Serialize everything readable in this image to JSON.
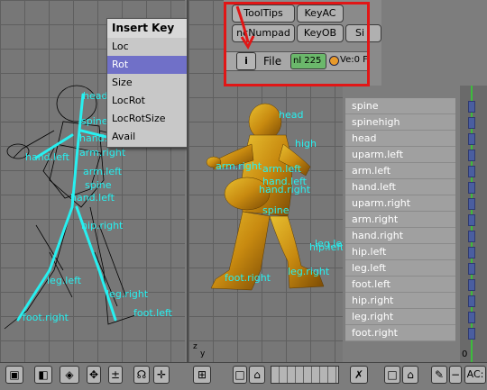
{
  "menu": {
    "title": "Insert Key",
    "items": [
      {
        "label": "Loc"
      },
      {
        "label": "Rot"
      },
      {
        "label": "Size"
      },
      {
        "label": "LocRot"
      },
      {
        "label": "LocRotSize"
      },
      {
        "label": "Avail"
      }
    ],
    "active_item": "Rot"
  },
  "header": {
    "tooltips": "ToolTips",
    "keyac": "KeyAC",
    "numpad": "ncNumpad",
    "keyob": "KeyOB",
    "si": "Si",
    "file": "File",
    "nl": "nl 225",
    "ve": "Ve:0 F"
  },
  "left_labels": [
    "head",
    "spine",
    "hand.right",
    "arm.right",
    "hand.left",
    "arm.left",
    "spine",
    "hand.left",
    "hip.right",
    "leg.left",
    "leg.right",
    "foot.right",
    "foot.left"
  ],
  "mid_labels": [
    "head",
    "high",
    "arm.left",
    "arm.right",
    "hand.left",
    "hand.right",
    "spine",
    "leg.left",
    "hip.left",
    "foot.right",
    "leg.right"
  ],
  "bones": [
    "spine",
    "spinehigh",
    "head",
    "uparm.left",
    "arm.left",
    "hand.left",
    "uparm.right",
    "arm.right",
    "hand.right",
    "hip.left",
    "leg.left",
    "foot.left",
    "hip.right",
    "leg.right",
    "foot.right"
  ],
  "axis": {
    "z": "z",
    "y": "y"
  },
  "frame": "0",
  "ac": "AC:",
  "colors": {
    "bone": "#27f0f0",
    "highlight": "#e11616",
    "menu_active": "#7070c8"
  }
}
